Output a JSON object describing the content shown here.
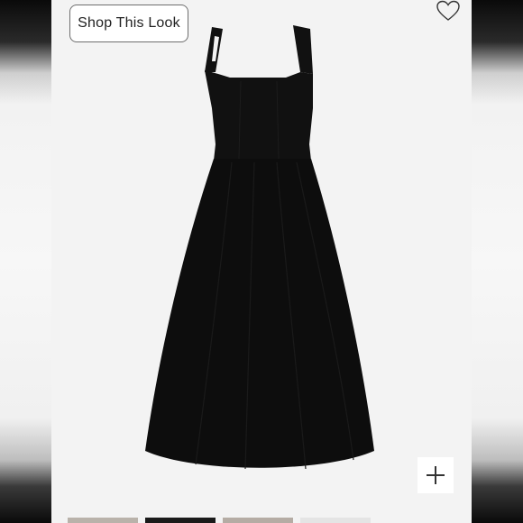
{
  "shop_button": {
    "label": "Shop This Look"
  },
  "icons": {
    "favorite": "heart-icon",
    "zoom": "plus-icon"
  },
  "product": {
    "image": "black-sleeveless-midi-dress",
    "dress_color": "#111111"
  },
  "thumbnails": [
    {
      "name": "thumbnail-1",
      "color": "#b9b2aa"
    },
    {
      "name": "thumbnail-2",
      "color": "#1a1a1a"
    },
    {
      "name": "thumbnail-3",
      "color": "#b5aca4"
    },
    {
      "name": "thumbnail-4",
      "color": "#e4e4e4"
    }
  ]
}
